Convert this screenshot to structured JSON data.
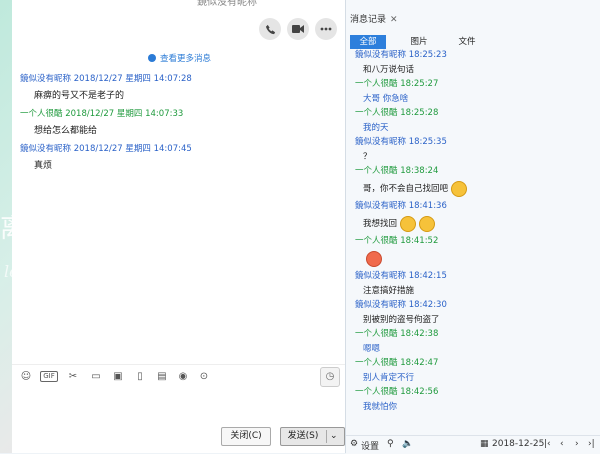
{
  "window": {
    "title": "鏡似没有昵称"
  },
  "chat": {
    "more_messages": "查看更多消息",
    "messages": [
      {
        "sender": "鏡似没有昵称",
        "time": "2018/12/27 星期四 14:07:28",
        "text": "麻痹的号又不是老子的",
        "side": "blue"
      },
      {
        "sender": "一个人很酷",
        "time": "2018/12/27 星期四 14:07:33",
        "text": "想给怎么都能给",
        "side": "green"
      },
      {
        "sender": "鏡似没有昵称",
        "time": "2018/12/27 星期四 14:07:45",
        "text": "真烦",
        "side": "blue"
      }
    ],
    "close_label": "关闭(C)",
    "send_label": "发送(S)",
    "bg_text": "离开",
    "bg_script": "leave"
  },
  "panel": {
    "tab_label": "消息记录",
    "subtabs": [
      "全部",
      "图片",
      "文件"
    ],
    "history": [
      {
        "kind": "meta",
        "color": "blue",
        "text": "鏡似没有昵称 18:25:23"
      },
      {
        "kind": "body",
        "text": "和八万说句话"
      },
      {
        "kind": "meta",
        "color": "green",
        "text": "一个人很酷 18:25:27"
      },
      {
        "kind": "body",
        "color": "blue",
        "text": "大哥 你急啥"
      },
      {
        "kind": "meta",
        "color": "green",
        "text": "一个人很酷 18:25:28"
      },
      {
        "kind": "body",
        "color": "blue",
        "text": "我的天"
      },
      {
        "kind": "meta",
        "color": "blue",
        "text": "鏡似没有昵称 18:25:35"
      },
      {
        "kind": "body",
        "text": "？"
      },
      {
        "kind": "meta",
        "color": "green",
        "text": "一个人很酷 18:38:24"
      },
      {
        "kind": "body",
        "big": true,
        "text": "哥，你不会自己找回吧",
        "emoji": [
          "laugh"
        ]
      },
      {
        "kind": "meta",
        "color": "blue",
        "text": "鏡似没有昵称 18:41:36"
      },
      {
        "kind": "body",
        "big": true,
        "text": "我想找回",
        "emoji": [
          "laugh",
          "laugh"
        ]
      },
      {
        "kind": "meta",
        "color": "green",
        "text": "一个人很酷 18:41:52"
      },
      {
        "kind": "body",
        "big": true,
        "text": "",
        "emoji": [
          "angry"
        ]
      },
      {
        "kind": "meta",
        "color": "blue",
        "text": "鏡似没有昵称 18:42:15"
      },
      {
        "kind": "body",
        "text": "注意搞好措施"
      },
      {
        "kind": "meta",
        "color": "blue",
        "text": "鏡似没有昵称 18:42:30"
      },
      {
        "kind": "body",
        "text": "别被别的盗号佝盗了"
      },
      {
        "kind": "meta",
        "color": "green",
        "text": "一个人很酷 18:42:38"
      },
      {
        "kind": "body",
        "color": "blue",
        "text": "嗯嗯"
      },
      {
        "kind": "meta",
        "color": "green",
        "text": "一个人很酷 18:42:47"
      },
      {
        "kind": "body",
        "color": "blue",
        "text": "别人肯定不行"
      },
      {
        "kind": "meta",
        "color": "green",
        "text": "一个人很酷 18:42:56"
      },
      {
        "kind": "body",
        "color": "blue",
        "text": "我就怕你"
      }
    ],
    "bottom": {
      "settings_label": "设置",
      "date": "2018-12-25"
    }
  },
  "colors": {
    "accent": "#2d7fdc",
    "sender_blue": "#2b62c8",
    "sender_green": "#1f9a3d"
  }
}
